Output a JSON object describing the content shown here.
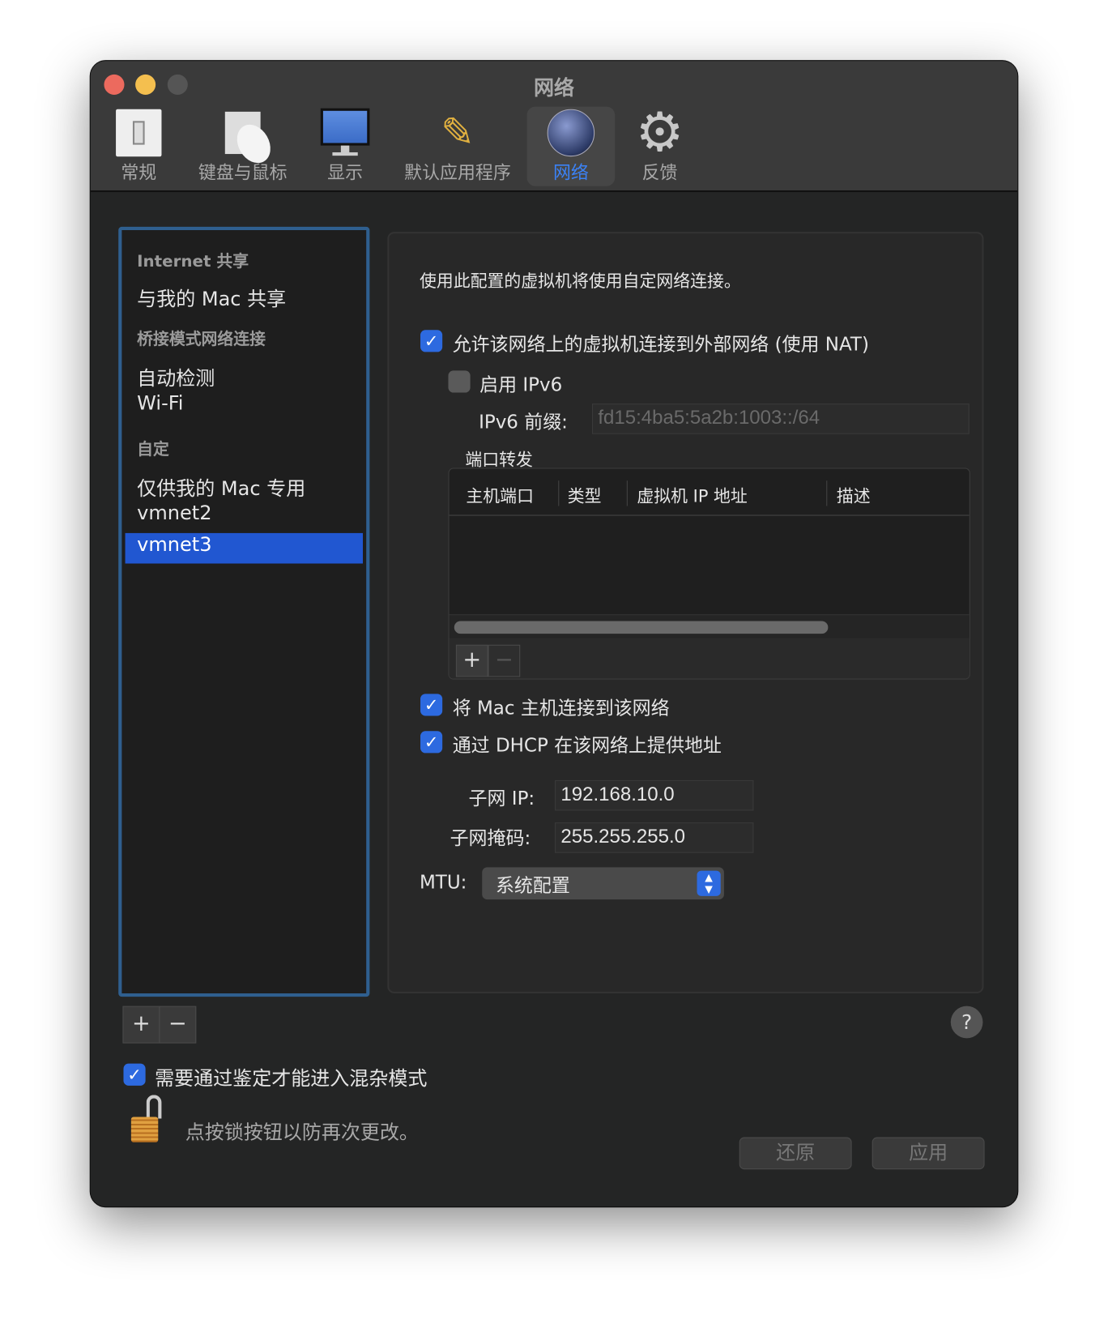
{
  "window": {
    "title": "网络"
  },
  "toolbar": [
    {
      "label": "常规",
      "icon": "switch-icon"
    },
    {
      "label": "键盘与鼠标",
      "icon": "mouse-icon"
    },
    {
      "label": "显示",
      "icon": "monitor-icon"
    },
    {
      "label": "默认应用程序",
      "icon": "app-icon"
    },
    {
      "label": "网络",
      "icon": "globe-icon",
      "selected": true
    },
    {
      "label": "反馈",
      "icon": "gear-icon"
    }
  ],
  "sidebar": {
    "h1": "Internet 共享",
    "i1": "与我的 Mac 共享",
    "h2": "桥接模式网络连接",
    "i2": "自动检测",
    "i3": "Wi-Fi",
    "h3": "自定",
    "i4": "仅供我的 Mac 专用",
    "i5": "vmnet2",
    "i6": "vmnet3",
    "selected": "vmnet3"
  },
  "panel": {
    "desc": "使用此配置的虚拟机将使用自定网络连接。",
    "nat_label": "允许该网络上的虚拟机连接到外部网络 (使用 NAT)",
    "nat_checked": true,
    "ipv6_label": "启用 IPv6",
    "ipv6_checked": false,
    "ipv6_prefix_label": "IPv6 前缀:",
    "ipv6_prefix_value": "fd15:4ba5:5a2b:1003::/64",
    "pf_label": "端口转发",
    "pf_columns": [
      "主机端口",
      "类型",
      "虚拟机 IP 地址",
      "描述"
    ],
    "pf_rows": [],
    "connect_mac_label": "将 Mac 主机连接到该网络",
    "connect_mac_checked": true,
    "dhcp_label": "通过 DHCP 在该网络上提供地址",
    "dhcp_checked": true,
    "subnet_ip_label": "子网 IP:",
    "subnet_ip_value": "192.168.10.0",
    "subnet_mask_label": "子网掩码:",
    "subnet_mask_value": "255.255.255.0",
    "mtu_label": "MTU:",
    "mtu_value": "系统配置"
  },
  "footer": {
    "promisc_label": "需要通过鉴定才能进入混杂模式",
    "promisc_checked": true,
    "lock_text": "点按锁按钮以防再次更改。",
    "revert": "还原",
    "apply": "应用",
    "help": "?",
    "plus": "+",
    "minus": "−"
  },
  "colors": {
    "accent": "#2d6ae0",
    "selection": "#2157d1"
  }
}
